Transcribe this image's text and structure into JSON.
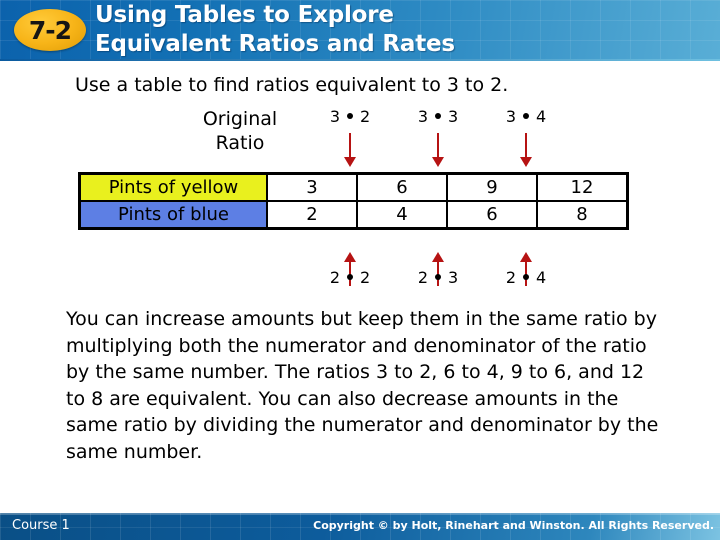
{
  "header": {
    "badge_label": "7-2",
    "title_line1": "Using Tables to Explore",
    "title_line2": "Equivalent Ratios and Rates",
    "badge_color": "#f7b418",
    "background_color": "#1270b4",
    "title_color": "#ffffff"
  },
  "intro": {
    "text": "Use a table to find ratios equivalent to 3 to 2."
  },
  "table_section": {
    "original_ratio_label_line1": "Original",
    "original_ratio_label_line2": "Ratio",
    "multipliers_top": [
      {
        "left": "3",
        "operator": "•",
        "right": "2"
      },
      {
        "left": "3",
        "operator": "•",
        "right": "3"
      },
      {
        "left": "3",
        "operator": "•",
        "right": "4"
      }
    ],
    "multipliers_bottom": [
      {
        "left": "2",
        "operator": "•",
        "right": "2"
      },
      {
        "left": "2",
        "operator": "•",
        "right": "3"
      },
      {
        "left": "2",
        "operator": "•",
        "right": "4"
      }
    ],
    "arrow_color": "#b61313",
    "rows": [
      {
        "label": "Pints of yellow",
        "label_color": "#e9f01e",
        "values": [
          "3",
          "6",
          "9",
          "12"
        ]
      },
      {
        "label": "Pints of blue",
        "label_color": "#5d7fe4",
        "values": [
          "2",
          "4",
          "6",
          "8"
        ]
      }
    ]
  },
  "body": {
    "paragraph": "You can increase amounts but keep them in the same ratio by multiplying both the numerator and denominator of the ratio by the same number. The ratios 3 to 2, 6 to 4, 9 to 6, and 12 to 8 are equivalent. You can also decrease amounts in the same ratio by dividing the numerator and denominator by the same number."
  },
  "footer": {
    "course": "Course 1",
    "copyright": "Copyright © by Holt, Rinehart and Winston. All Rights Reserved."
  }
}
